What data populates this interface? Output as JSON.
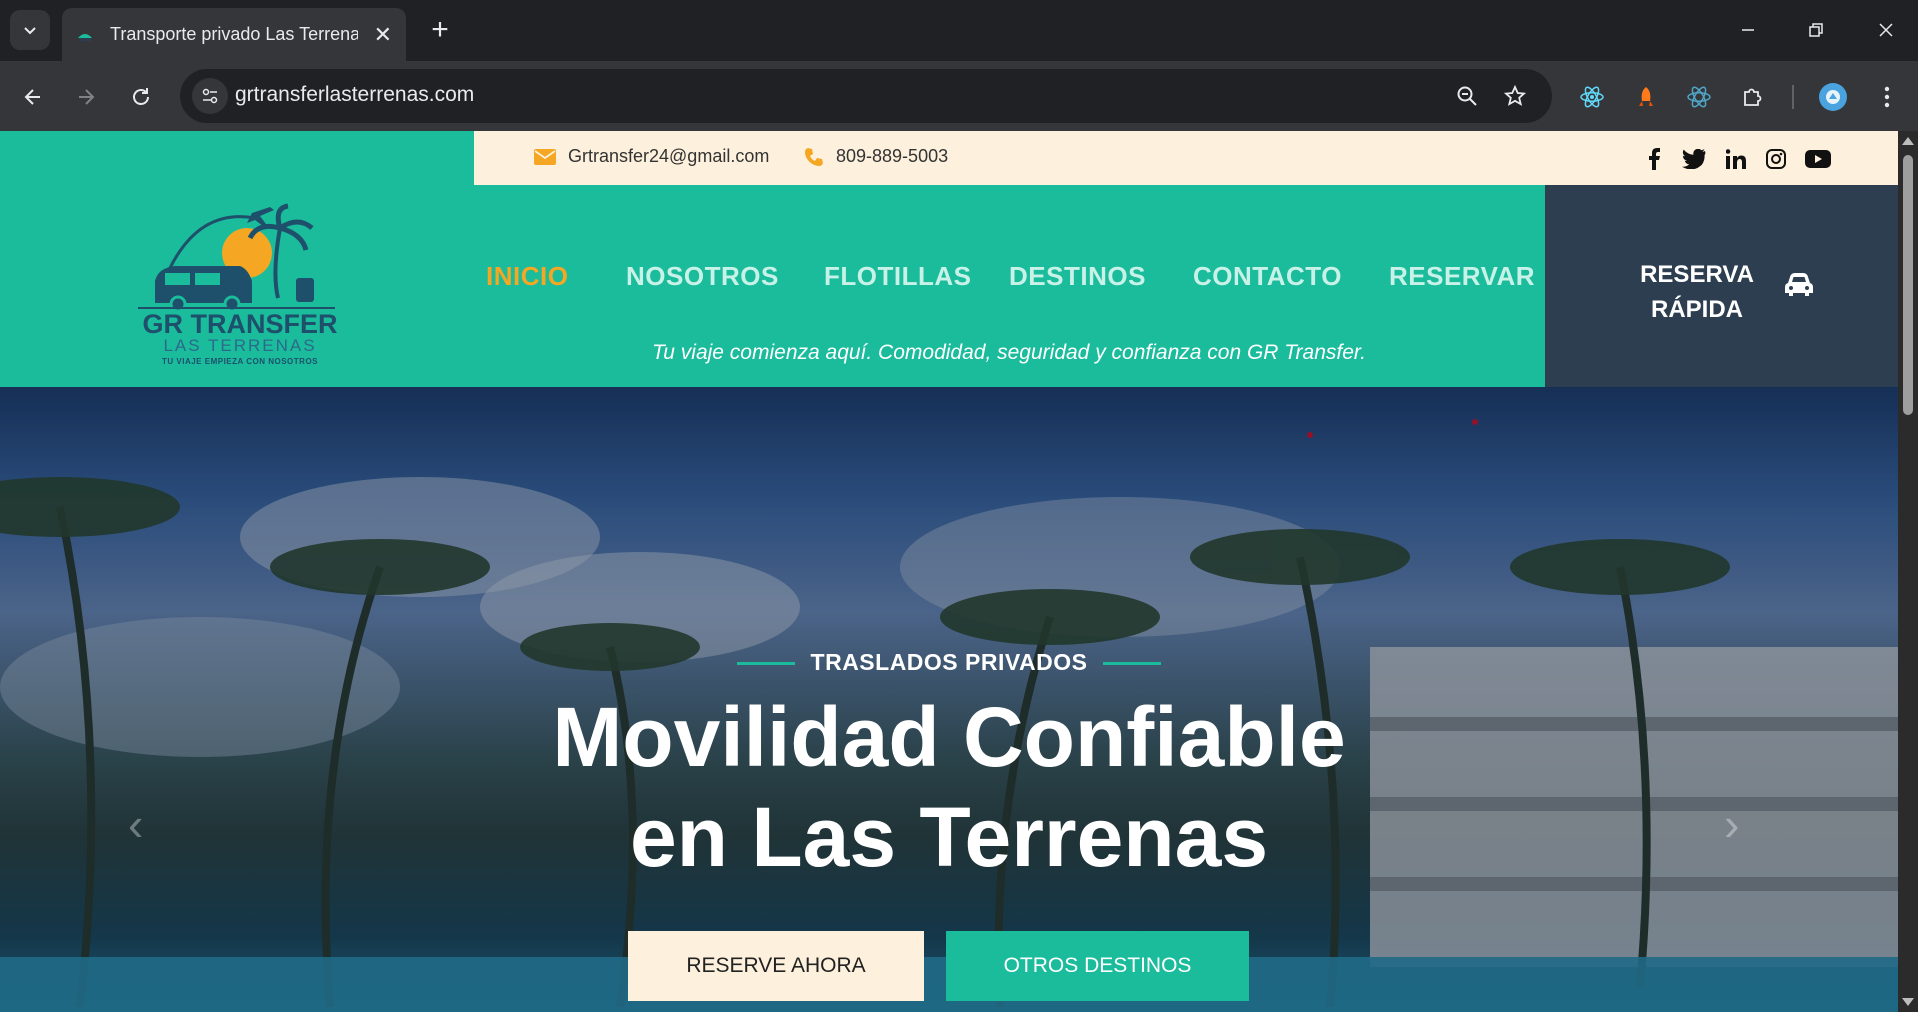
{
  "browser": {
    "tab_title": "Transporte privado Las Terrenas",
    "url": "grtransferlasterrenas.com"
  },
  "topbar": {
    "email": "Grtransfer24@gmail.com",
    "phone": "809-889-5003"
  },
  "logo": {
    "name": "GR TRANSFER",
    "place": "LAS TERRENAS",
    "slogan": "TU VIAJE EMPIEZA CON NOSOTROS"
  },
  "nav": {
    "items": [
      "INICIO",
      "NOSOTROS",
      "FLOTILLAS",
      "DESTINOS",
      "CONTACTO",
      "RESERVAR"
    ],
    "active": "INICIO"
  },
  "tagline": "Tu viaje comienza aquí. Comodidad, seguridad y confianza con GR Transfer.",
  "quick_reserve": {
    "label_line1": "RESERVA",
    "label_line2": "RÁPIDA"
  },
  "hero": {
    "subtitle": "TRASLADOS PRIVADOS",
    "title_line1": "Movilidad Confiable",
    "title_line2": "en Las Terrenas",
    "button_reserve": "RESERVE AHORA",
    "button_other": "OTROS DESTINOS"
  },
  "colors": {
    "brand_teal": "#1abc9c",
    "accent_orange": "#f5a623",
    "topbar_cream": "#fdf0dc",
    "quick_navy": "#2c3e50"
  }
}
